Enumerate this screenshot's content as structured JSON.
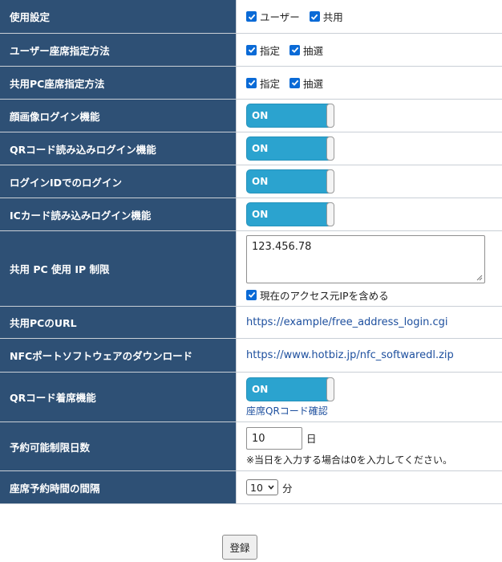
{
  "rows": {
    "usage": {
      "label": "使用設定",
      "options": [
        "ユーザー",
        "共用"
      ]
    },
    "user_seat": {
      "label": "ユーザー座席指定方法",
      "options": [
        "指定",
        "抽選"
      ]
    },
    "shared_pc_seat": {
      "label": "共用PC座席指定方法",
      "options": [
        "指定",
        "抽選"
      ]
    },
    "face_login": {
      "label": "顔画像ログイン機能",
      "toggle": "ON"
    },
    "qr_login": {
      "label": "QRコード読み込みログイン機能",
      "toggle": "ON"
    },
    "id_login": {
      "label": "ログインIDでのログイン",
      "toggle": "ON"
    },
    "ic_login": {
      "label": "ICカード読み込みログイン機能",
      "toggle": "ON"
    },
    "ip_limit": {
      "label": "共用 PC 使用 IP 制限",
      "value": "123.456.78",
      "checkbox": "現在のアクセス元IPを含める"
    },
    "shared_url": {
      "label": "共用PCのURL",
      "link": "https://example/free_address_login.cgi"
    },
    "nfc_download": {
      "label": "NFCポートソフトウェアのダウンロード",
      "link": "https://www.hotbiz.jp/nfc_softwaredl.zip"
    },
    "qr_seat": {
      "label": "QRコード着席機能",
      "toggle": "ON",
      "link": "座席QRコード確認"
    },
    "reserve_days": {
      "label": "予約可能制限日数",
      "value": "10",
      "unit": "日",
      "note": "※当日を入力する場合は0を入力してください。"
    },
    "reserve_interval": {
      "label": "座席予約時間の間隔",
      "value": "10",
      "unit": "分"
    }
  },
  "submit_label": "登録",
  "colors": {
    "label_bg": "#2e5075",
    "toggle_bg": "#2ba3cf",
    "checkbox": "#0a6ad6",
    "link": "#1d4f9e"
  },
  "icons": {
    "checkbox": "check-icon",
    "select": "chevron-down-icon"
  }
}
